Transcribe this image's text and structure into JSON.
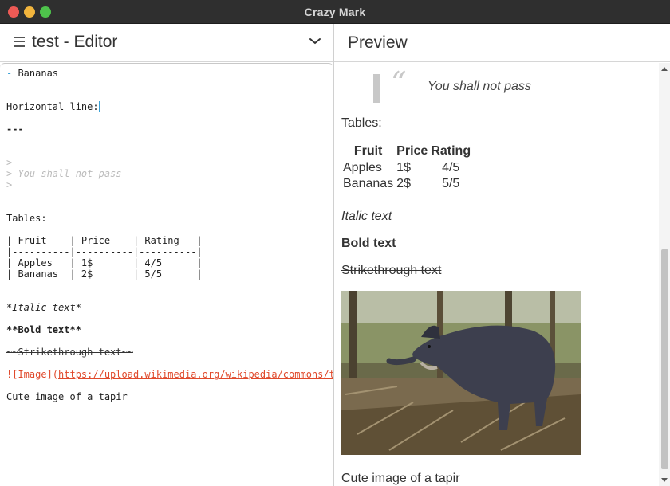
{
  "window": {
    "title": "Crazy Mark"
  },
  "editor": {
    "title": "test - Editor",
    "lines": {
      "bananas_marker": "-",
      "bananas_text": " Bananas",
      "hline_label": "Horizontal line:",
      "hline_md": "---",
      "bq_open": ">",
      "bq_text": "> You shall not pass",
      "bq_close": ">",
      "tables_label": "Tables:",
      "table_rows": [
        "| Fruit    | Price    | Rating   |",
        "|----------|----------|----------|",
        "| Apples   | 1$       | 4/5      |",
        "| Bananas  | 2$       | 5/5      |"
      ],
      "italic_md": "*Italic text*",
      "bold_md": "**Bold text**",
      "strike_md": "~~Strikethrough text~~",
      "image_md_prefix": "![Image](",
      "image_md_url": "https://upload.wikimedia.org/wikipedia/commons/t",
      "caption_md": "Cute image of a tapir"
    }
  },
  "preview": {
    "title": "Preview",
    "quote_mark": "“",
    "blockquote": "You shall not pass",
    "tables_label": "Tables:",
    "table": {
      "headers": [
        "Fruit",
        "Price",
        "Rating"
      ],
      "rows": [
        [
          "Apples",
          "1$",
          "4/5"
        ],
        [
          "Bananas",
          "2$",
          "5/5"
        ]
      ]
    },
    "italic": "Italic text",
    "bold": "Bold text",
    "strike": "Strikethrough text",
    "caption": "Cute image of a tapir",
    "image_alt": "Image"
  },
  "icons": {
    "menu": "hamburger-icon",
    "dropdown": "chevron-down-icon",
    "scroll_up": "arrow-up-icon",
    "scroll_down": "arrow-down-icon"
  },
  "colors": {
    "accent": "#3aa1d6",
    "image_link": "#e0492b",
    "blockquote": "#c8c8c8"
  }
}
